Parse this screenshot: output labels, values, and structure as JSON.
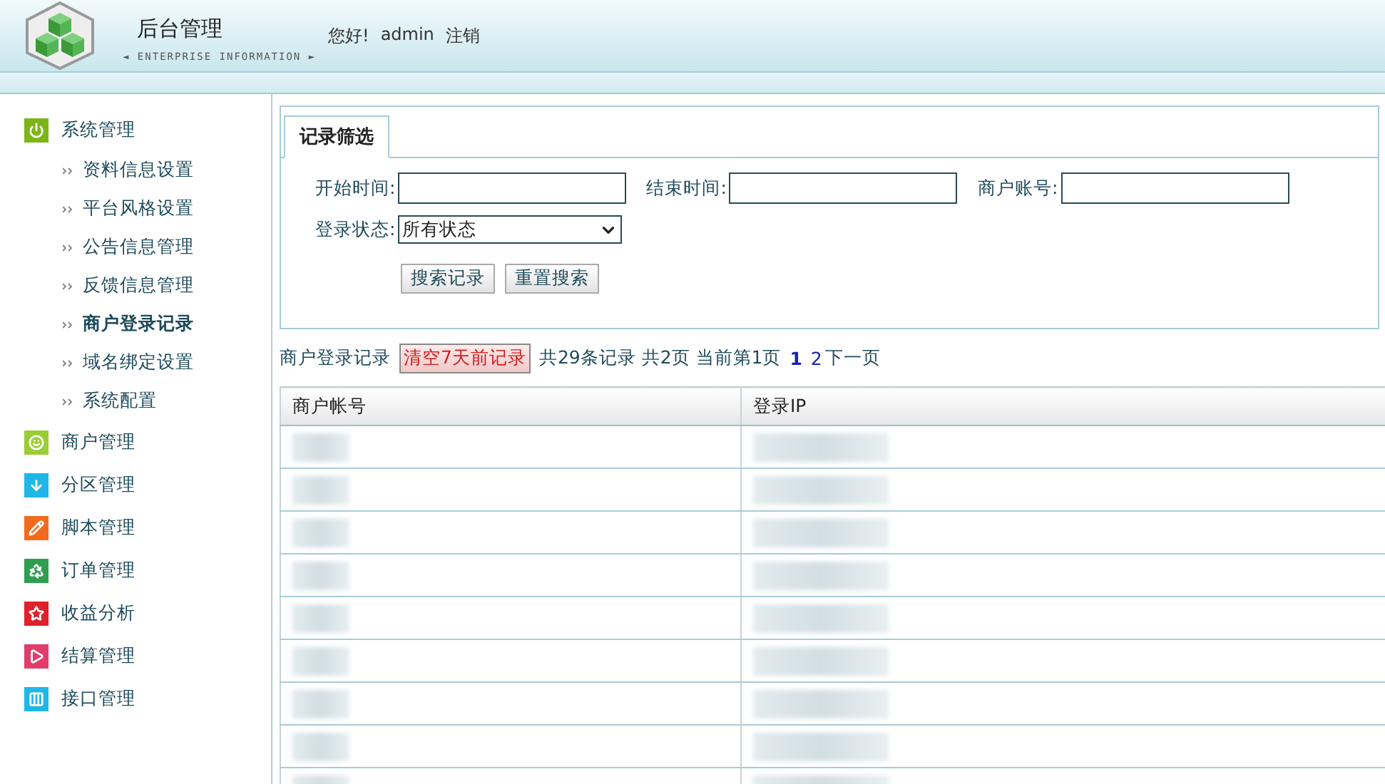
{
  "header": {
    "title": "后台管理",
    "subtitle": "◄ ENTERPRISE INFORMATION ►",
    "greeting": "您好!",
    "username": "admin",
    "logout": "注销"
  },
  "sidebar": {
    "groups": [
      {
        "label": "系统管理",
        "kind": "power",
        "color": "#7cb518",
        "children": [
          {
            "label": "资料信息设置",
            "selected": false
          },
          {
            "label": "平台风格设置",
            "selected": false
          },
          {
            "label": "公告信息管理",
            "selected": false
          },
          {
            "label": "反馈信息管理",
            "selected": false
          },
          {
            "label": "商户登录记录",
            "selected": true
          },
          {
            "label": "域名绑定设置",
            "selected": false
          },
          {
            "label": "系统配置",
            "selected": false
          }
        ]
      },
      {
        "label": "商户管理",
        "kind": "smile",
        "color": "#9acd32"
      },
      {
        "label": "分区管理",
        "kind": "download",
        "color": "#1fb6e8"
      },
      {
        "label": "脚本管理",
        "kind": "pencil",
        "color": "#f26b1d"
      },
      {
        "label": "订单管理",
        "kind": "recycle",
        "color": "#2e9e4f"
      },
      {
        "label": "收益分析",
        "kind": "star",
        "color": "#e0202a"
      },
      {
        "label": "结算管理",
        "kind": "play",
        "color": "#e23c6a"
      },
      {
        "label": "接口管理",
        "kind": "columns",
        "color": "#1fb6e8"
      }
    ]
  },
  "filter": {
    "tab": "记录筛选",
    "fields": [
      {
        "label": "开始时间:",
        "kind": "text"
      },
      {
        "label": "结束时间:",
        "kind": "text"
      },
      {
        "label": "商户账号:",
        "kind": "text"
      },
      {
        "label": "登录状态:",
        "kind": "select",
        "value": "所有状态"
      }
    ],
    "buttons": [
      "搜索记录",
      "重置搜索"
    ]
  },
  "pager": {
    "title": "商户登录记录",
    "clear_button": "清空7天前记录",
    "summary": "共29条记录 共2页 当前第1页",
    "pages": [
      {
        "label": "1",
        "selected": true
      },
      {
        "label": "2",
        "selected": false
      }
    ],
    "next": "下一页"
  },
  "table": {
    "columns": [
      "商户帐号",
      "登录IP"
    ],
    "rows": [
      {
        "redacted": true
      },
      {
        "redacted": true
      },
      {
        "redacted": true
      },
      {
        "redacted": true
      },
      {
        "redacted": true
      },
      {
        "redacted": true
      },
      {
        "redacted": true
      },
      {
        "redacted": true
      },
      {
        "redacted": true
      }
    ]
  }
}
